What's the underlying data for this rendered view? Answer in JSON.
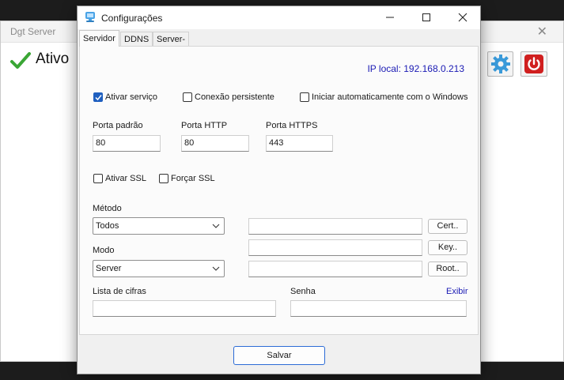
{
  "background_window": {
    "title": "Dgt Server",
    "status": "Ativo",
    "close_glyph": "✕"
  },
  "dialog": {
    "title": "Configurações",
    "tabs": [
      "Servidor",
      "DDNS",
      "Server-side"
    ],
    "ip_local": "IP local: 192.168.0.213",
    "checkboxes": {
      "ativar_servico": {
        "label": "Ativar serviço",
        "checked": true
      },
      "conexao_persistente": {
        "label": "Conexão persistente",
        "checked": false
      },
      "iniciar_auto": {
        "label": "Iniciar automaticamente com o Windows",
        "checked": false
      },
      "ativar_ssl": {
        "label": "Ativar SSL",
        "checked": false
      },
      "forcar_ssl": {
        "label": "Forçar SSL",
        "checked": false
      }
    },
    "ports": {
      "padrao_label": "Porta padrão",
      "padrao_value": "80",
      "http_label": "Porta HTTP",
      "http_value": "80",
      "https_label": "Porta HTTPS",
      "https_value": "443"
    },
    "metodo": {
      "label": "Método",
      "value": "Todos"
    },
    "modo": {
      "label": "Modo",
      "value": "Server"
    },
    "cert_buttons": {
      "cert": "Cert..",
      "key": "Key..",
      "root": "Root.."
    },
    "cert_fields": {
      "cert": "",
      "key": "",
      "root": ""
    },
    "lista_cifras": {
      "label": "Lista de cifras",
      "value": ""
    },
    "senha": {
      "label": "Senha",
      "value": "",
      "toggle": "Exibir"
    },
    "save_label": "Salvar"
  },
  "colors": {
    "accent": "#1f5fbf",
    "link": "#1a1ab4",
    "status_check": "#3aa635",
    "power": "#d01f1f"
  },
  "icons": [
    "check-icon",
    "gear-icon",
    "power-icon",
    "app-icon",
    "minimize-icon",
    "maximize-icon",
    "close-icon",
    "chevron-down-icon"
  ]
}
